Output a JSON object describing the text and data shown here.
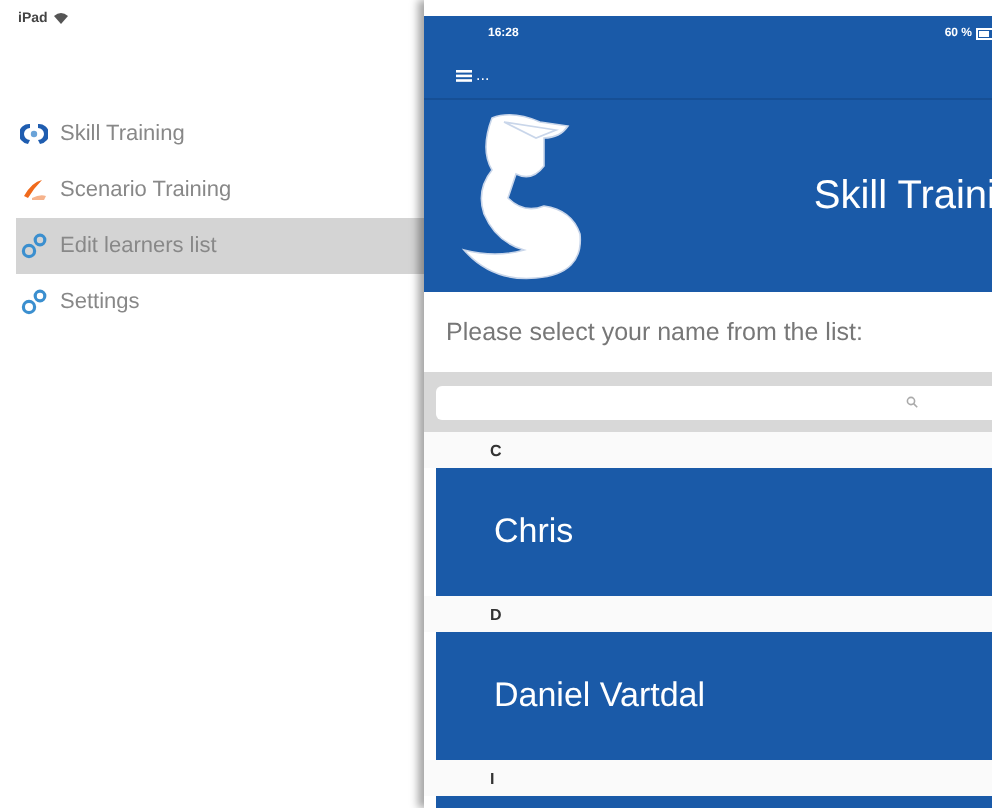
{
  "sidebar": {
    "device_status": "iPad",
    "items": [
      {
        "label": "Skill Training",
        "kind": "skill",
        "selected": false
      },
      {
        "label": "Scenario Training",
        "kind": "scenario",
        "selected": false
      },
      {
        "label": "Edit learners list",
        "kind": "gear",
        "selected": true
      },
      {
        "label": "Settings",
        "kind": "gear",
        "selected": false
      }
    ]
  },
  "app": {
    "status_bar": {
      "time": "16:28",
      "battery": "60 %"
    },
    "nav": {
      "menu_label": "..."
    },
    "header": {
      "title": "Skill Traini"
    },
    "prompt": "Please select your name from the list:",
    "sections": [
      {
        "letter": "C",
        "entries": [
          "Chris"
        ]
      },
      {
        "letter": "D",
        "entries": [
          "Daniel Vartdal"
        ]
      },
      {
        "letter": "I"
      }
    ]
  }
}
